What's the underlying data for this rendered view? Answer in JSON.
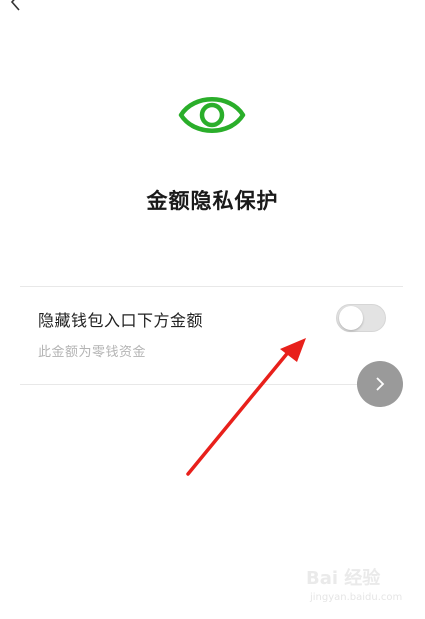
{
  "header": {
    "back_icon": "chevron-left-icon"
  },
  "hero": {
    "icon": "eye-icon",
    "title": "金额隐私保护"
  },
  "setting": {
    "label": "隐藏钱包入口下方金额",
    "description": "此金额为零钱资金",
    "toggle_on": false
  },
  "next_button": {
    "icon": "chevron-right-icon"
  },
  "annotation": {
    "arrow_color": "#e8201b"
  },
  "watermark": {
    "brand": "Bai 经验",
    "site": "jingyan.baidu.com"
  },
  "colors": {
    "accent_green": "#2aae2a",
    "toggle_off": "#e3e3e3",
    "next_button": "#9a9a9a"
  }
}
